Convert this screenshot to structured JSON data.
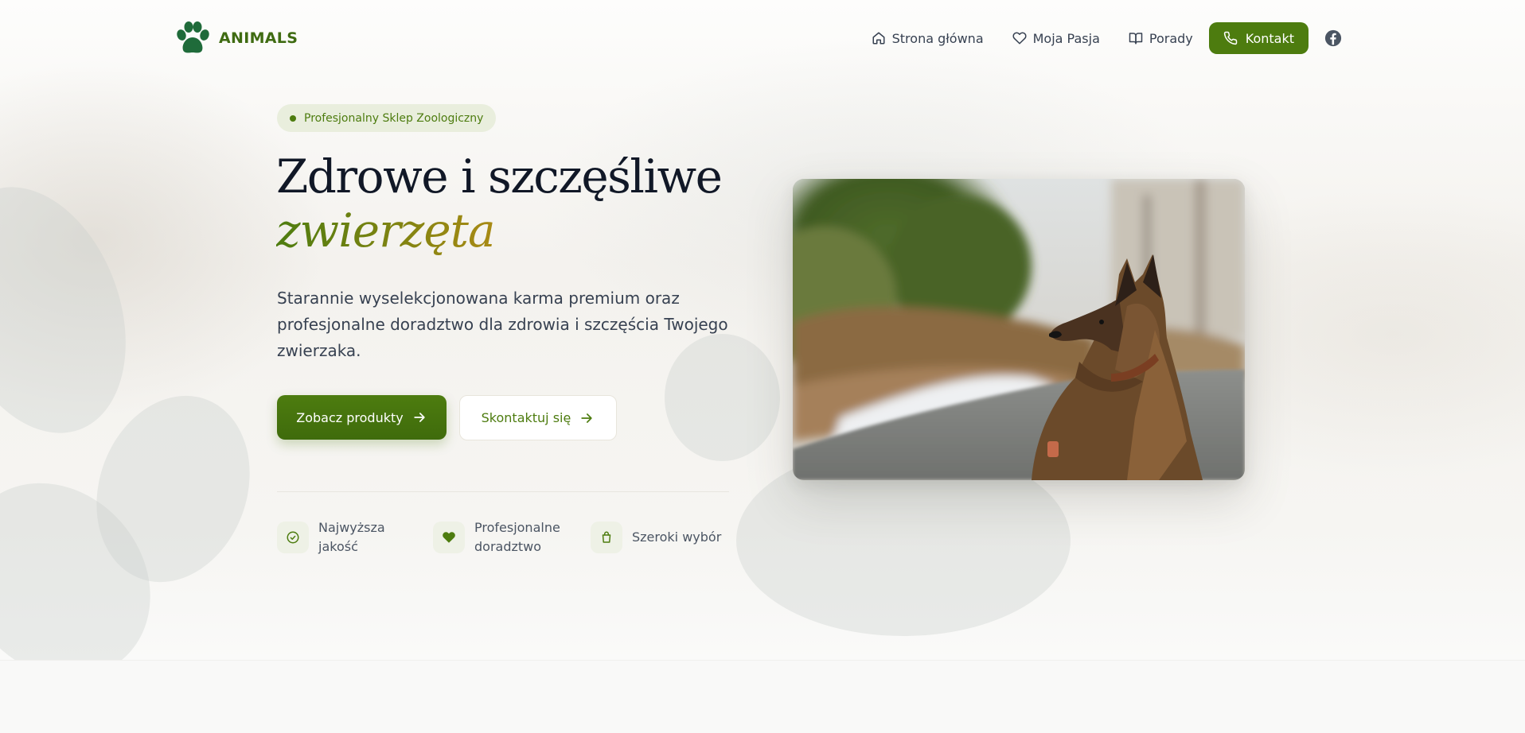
{
  "brand": {
    "name": "ANIMALS",
    "logo_icon": "paw-icon",
    "color": "#3f6b12"
  },
  "nav": {
    "items": [
      {
        "label": "Strona główna",
        "icon": "home-icon"
      },
      {
        "label": "Moja Pasja",
        "icon": "heart-icon"
      },
      {
        "label": "Porady",
        "icon": "book-icon"
      }
    ],
    "cta": {
      "label": "Kontakt",
      "icon": "phone-icon"
    },
    "social": {
      "icon": "facebook-icon"
    }
  },
  "hero": {
    "badge": "Profesjonalny Sklep Zoologiczny",
    "title": "Zdrowe i szczęśliwe",
    "title_accent": "zwierzęta",
    "lead": "Starannie wyselekcjonowana karma premium oraz profesjonalne doradztwo dla zdrowia i szczęścia Twojego zwierzaka.",
    "primary_button": "Zobacz produkty",
    "secondary_button": "Skontaktuj się",
    "features": [
      {
        "label_line1": "Najwyższa",
        "label_line2": "jakość",
        "icon": "check-circle-icon"
      },
      {
        "label_line1": "Profesjonalne",
        "label_line2": "doradztwo",
        "icon": "heart-icon"
      },
      {
        "label_line1": "Szeroki wybór",
        "label_line2": "",
        "icon": "shopping-bag-icon"
      }
    ],
    "image_alt": "German shepherd dog"
  },
  "colors": {
    "accent": "#4d7c0f",
    "accent_gold": "#a98a14",
    "text": "#111827"
  }
}
